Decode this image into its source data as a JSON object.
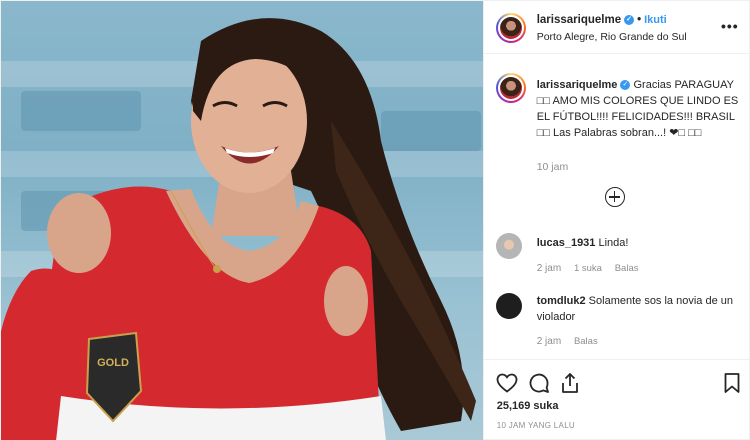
{
  "post": {
    "username": "larissariquelme",
    "follow_label": "Ikuti",
    "location": "Porto Alegre, Rio Grande do Sul",
    "more_label": "•••"
  },
  "caption": {
    "username": "larissariquelme",
    "text": "Gracias PARAGUAY □□ AMO MIS COLORES QUE LINDO ES EL FÚTBOL!!!! FELICIDADES!!! BRASIL □□ Las Palabras sobran...! ❤□ □□",
    "time": "10 jam"
  },
  "comments": [
    {
      "username": "lucas_1931",
      "text": "Linda!",
      "time": "2 jam",
      "likes": "1 suka",
      "reply_label": "Balas"
    },
    {
      "username": "tomdluk2",
      "text": "Solamente sos la novia de un violador",
      "time": "2 jam",
      "reply_label": "Balas"
    }
  ],
  "footer": {
    "likes": "25,169 suka",
    "posted": "10 JAM YANG LALU"
  },
  "icons": {
    "like": "heart-icon",
    "comment": "comment-icon",
    "share": "share-icon",
    "save": "bookmark-icon",
    "load_more": "plus-circle-icon"
  },
  "colors": {
    "link_blue": "#3897f0",
    "text": "#262626",
    "muted": "#8e8e8e",
    "border": "#efefef"
  }
}
